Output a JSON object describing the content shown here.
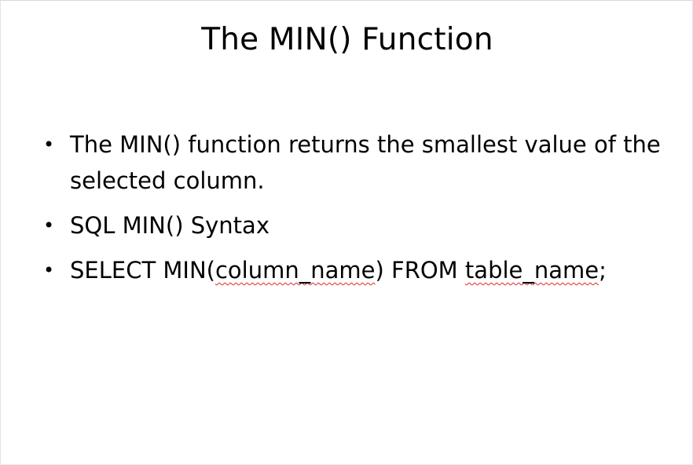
{
  "slide": {
    "title": "The MIN() Function",
    "bullet_symbol": "•",
    "bullets": [
      {
        "text": "The MIN() function returns the smallest value of the selected column."
      },
      {
        "text": "SQL MIN() Syntax"
      },
      {
        "parts": {
          "p1": "SELECT MIN(",
          "p2": "column_name",
          "p3": ") FROM ",
          "p4": "table_name",
          "p5": ";"
        }
      }
    ],
    "spellcheck_color": "#e0272a"
  }
}
